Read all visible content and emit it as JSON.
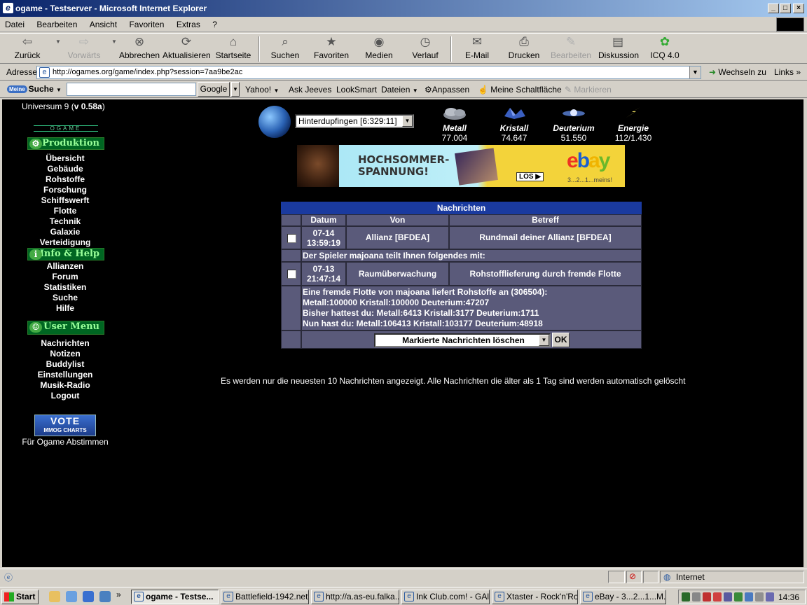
{
  "window": {
    "title": "ogame - Testserver - Microsoft Internet Explorer"
  },
  "menubar": {
    "items": [
      "Datei",
      "Bearbeiten",
      "Ansicht",
      "Favoriten",
      "Extras",
      "?"
    ]
  },
  "toolbar": {
    "back": "Zurück",
    "forward": "Vorwärts",
    "stop": "Abbrechen",
    "refresh": "Aktualisieren",
    "home": "Startseite",
    "search": "Suchen",
    "favorites": "Favoriten",
    "media": "Medien",
    "history": "Verlauf",
    "mail": "E-Mail",
    "print": "Drucken",
    "edit": "Bearbeiten",
    "discuss": "Diskussion",
    "icq": "ICQ 4.0"
  },
  "addressbar": {
    "label": "Adresse",
    "url": "http://ogames.org/game/index.php?session=7aa9be2ac",
    "goto": "Wechseln zu",
    "links": "Links"
  },
  "searchbar": {
    "label": "Suche",
    "badge": "Meine",
    "google": "Google",
    "yahoo": "Yahoo!",
    "askjeeves": "Ask Jeeves",
    "looksmart": "LookSmart",
    "dateien": "Dateien",
    "anpassen": "Anpassen",
    "schaltflaeche": "Meine Schaltfläche",
    "markieren": "Markieren"
  },
  "leftmenu": {
    "universe_prefix": "Universum 9 (",
    "universe_version": "v 0.58a",
    "universe_suffix": ")",
    "logo": "OGAME",
    "produktion": "Produktion",
    "produktion_items": [
      "Übersicht",
      "Gebäude",
      "Rohstoffe",
      "Forschung",
      "Schiffswerft",
      "Flotte",
      "Technik",
      "Galaxie",
      "Verteidigung"
    ],
    "info": "Info & Help",
    "info_items": [
      "Allianzen",
      "Forum",
      "Statistiken",
      "Suche",
      "Hilfe"
    ],
    "user": "User Menu",
    "user_items": [
      "Nachrichten",
      "Notizen",
      "Buddylist",
      "Einstellungen",
      "Musik-Radio",
      "Logout"
    ],
    "vote_big": "VOTE",
    "vote_small": "MMOG CHARTS",
    "vote_text": "Für Ogame Abstimmen"
  },
  "header": {
    "planet": "Hinterdupfingen [6:329:11]",
    "resources": [
      {
        "name": "Metall",
        "value": "77.004"
      },
      {
        "name": "Kristall",
        "value": "74.647"
      },
      {
        "name": "Deuterium",
        "value": "51.550"
      },
      {
        "name": "Energie",
        "value": "112/1.430"
      }
    ]
  },
  "banner": {
    "line1": "HOCHSOMMER-",
    "line2": "SPANNUNG!",
    "los": "LOS ▶",
    "ebay": "ebay",
    "slogan": "3...2...1...meins!"
  },
  "messages": {
    "title": "Nachrichten",
    "columns": [
      "Datum",
      "Von",
      "Betreff"
    ],
    "rows": [
      {
        "date": "07-14",
        "time": "13:59:19",
        "from": "Allianz [BFDEA]",
        "subject": "Rundmail deiner Allianz [BFDEA]",
        "body": [
          "Der Spieler majoana teilt Ihnen folgendes mit:"
        ]
      },
      {
        "date": "07-13",
        "time": "21:47:14",
        "from": "Raumüberwachung",
        "subject": "Rohstofflieferung durch fremde Flotte",
        "body": [
          "Eine fremde Flotte von majoana liefert Rohstoffe an (306504):",
          "Metall:100000 Kristall:100000 Deuterium:47207",
          "Bisher hattest du: Metall:6413 Kristall:3177 Deuterium:1711",
          "Nun hast du: Metall:106413 Kristall:103177 Deuterium:48918"
        ]
      }
    ],
    "action": "Markierte Nachrichten löschen",
    "ok": "OK",
    "notice": "Es werden nur die neuesten 10 Nachrichten angezeigt. Alle Nachrichten die älter als 1 Tag sind werden automatisch gelöscht"
  },
  "statusbar": {
    "zone": "Internet"
  },
  "taskbar": {
    "start": "Start",
    "tasks": [
      "ogame - Testse...",
      "Battlefield-1942.net...",
      "http://a.as-eu.falka...",
      "Ink Club.com! - GAl...",
      "Xtaster - Rock'n'Ro...",
      "eBay - 3...2...1...M..."
    ],
    "clock": "14:36"
  }
}
